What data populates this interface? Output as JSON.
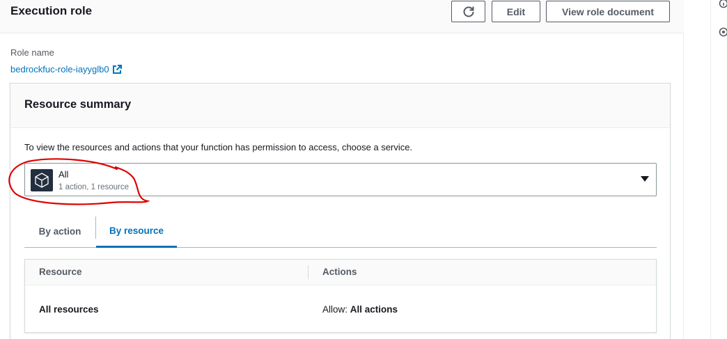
{
  "panel": {
    "title": "Execution role",
    "edit_label": "Edit",
    "view_label": "View role document"
  },
  "role": {
    "label": "Role name",
    "name": "bedrockfuc-role-iayyglb0"
  },
  "summary": {
    "title": "Resource summary",
    "description": "To view the resources and actions that your function has permission to access, choose a service.",
    "select": {
      "label": "All",
      "sublabel": "1 action, 1 resource",
      "icon": "service-cube-icon"
    },
    "tabs": [
      {
        "label": "By action",
        "active": false
      },
      {
        "label": "By resource",
        "active": true
      }
    ],
    "table": {
      "headers": [
        "Resource",
        "Actions"
      ],
      "rows": [
        {
          "resource": "All resources",
          "actions_prefix": "Allow:",
          "actions_value": "All actions"
        }
      ]
    }
  },
  "colors": {
    "link": "#0073bb",
    "annotation": "#e00000",
    "icon_bg": "#232f3e"
  }
}
